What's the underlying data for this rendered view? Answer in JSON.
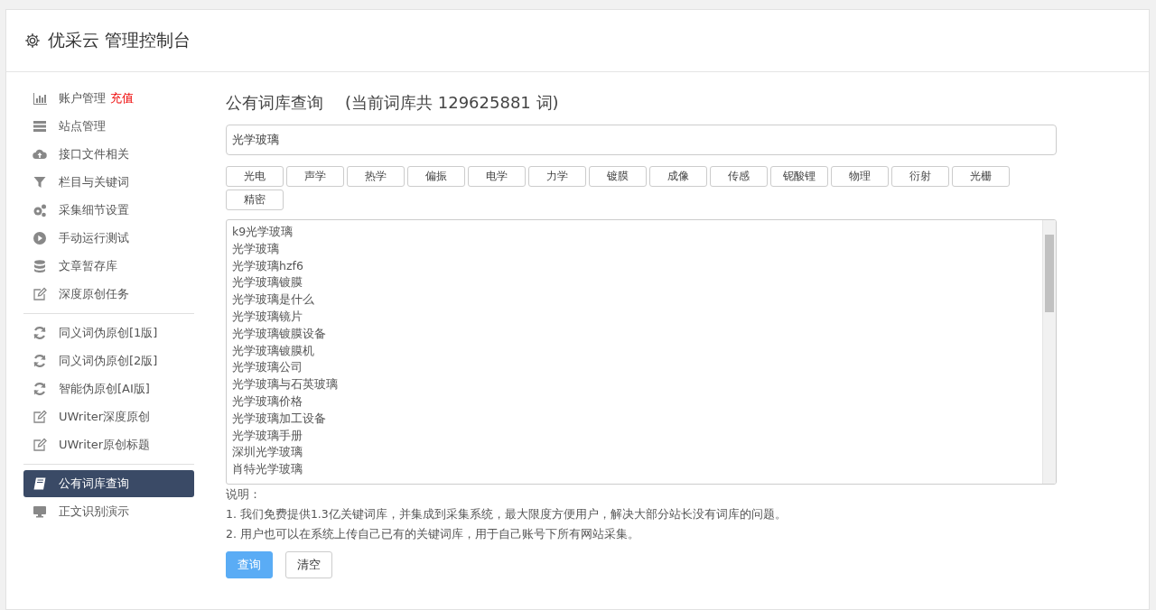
{
  "header": {
    "title": "优采云 管理控制台"
  },
  "sidebar": {
    "groups": [
      {
        "items": [
          {
            "label": "账户管理",
            "badge": "充值",
            "selected": false
          },
          {
            "label": "站点管理",
            "selected": false
          },
          {
            "label": "接口文件相关",
            "selected": false
          },
          {
            "label": "栏目与关键词",
            "selected": false
          },
          {
            "label": "采集细节设置",
            "selected": false
          },
          {
            "label": "手动运行测试",
            "selected": false
          },
          {
            "label": "文章暂存库",
            "selected": false
          },
          {
            "label": "深度原创任务",
            "selected": false
          }
        ]
      },
      {
        "items": [
          {
            "label": "同义词伪原创[1版]",
            "selected": false
          },
          {
            "label": "同义词伪原创[2版]",
            "selected": false
          },
          {
            "label": "智能伪原创[AI版]",
            "selected": false
          },
          {
            "label": "UWriter深度原创",
            "selected": false
          },
          {
            "label": "UWriter原创标题",
            "selected": false
          }
        ]
      },
      {
        "items": [
          {
            "label": "公有词库查询",
            "selected": true
          },
          {
            "label": "正文识别演示",
            "selected": false
          }
        ]
      }
    ]
  },
  "main": {
    "title": "公有词库查询",
    "count_note": "(当前词库共 129625881 词)",
    "search": {
      "value": "光学玻璃"
    },
    "tags": [
      "光电",
      "声学",
      "热学",
      "偏振",
      "电学",
      "力学",
      "镀膜",
      "成像",
      "传感",
      "铌酸锂",
      "物理",
      "衍射",
      "光栅",
      "精密"
    ],
    "results": [
      "k9光学玻璃",
      "光学玻璃",
      "光学玻璃hzf6",
      "光学玻璃镀膜",
      "光学玻璃是什么",
      "光学玻璃镜片",
      "光学玻璃镀膜设备",
      "光学玻璃镀膜机",
      "光学玻璃公司",
      "光学玻璃与石英玻璃",
      "光学玻璃价格",
      "光学玻璃加工设备",
      "光学玻璃手册",
      "深圳光学玻璃",
      "肖特光学玻璃"
    ],
    "notes_title": "说明：",
    "notes": [
      "1. 我们免费提供1.3亿关键词库，并集成到采集系统，最大限度方便用户，解决大部分站长没有词库的问题。",
      "2. 用户也可以在系统上传自己已有的关键词库，用于自己账号下所有网站采集。"
    ],
    "buttons": [
      {
        "label": "查询",
        "kind": "primary"
      },
      {
        "label": "清空",
        "kind": "default"
      }
    ]
  }
}
